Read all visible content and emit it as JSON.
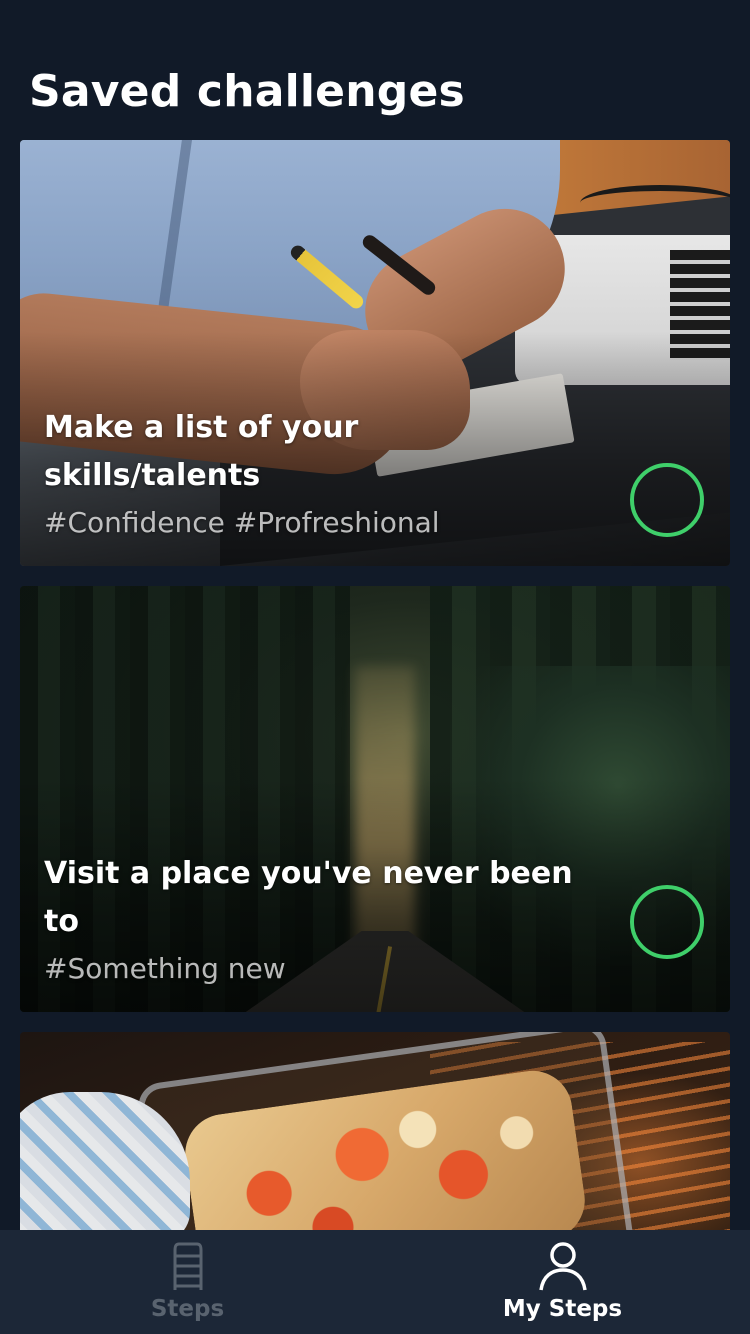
{
  "page": {
    "title": "Saved challenges"
  },
  "challenges": [
    {
      "title": "Make a list of your skills/talents",
      "tags": "#Confidence #Profreshional",
      "completed": false
    },
    {
      "title": "Visit a place you've never been to",
      "tags": "#Something new",
      "completed": false
    },
    {
      "title": "",
      "tags": "",
      "completed": false
    }
  ],
  "tab_bar": {
    "tabs": [
      {
        "label": "Steps",
        "icon": "ladder-icon",
        "active": false
      },
      {
        "label": "My Steps",
        "icon": "person-icon",
        "active": true
      }
    ]
  },
  "colors": {
    "background": "#111a28",
    "tab_bar": "#1c2737",
    "accent_ring": "#3fcf6a",
    "tab_inactive": "#59636f",
    "tab_active": "#ffffff"
  }
}
